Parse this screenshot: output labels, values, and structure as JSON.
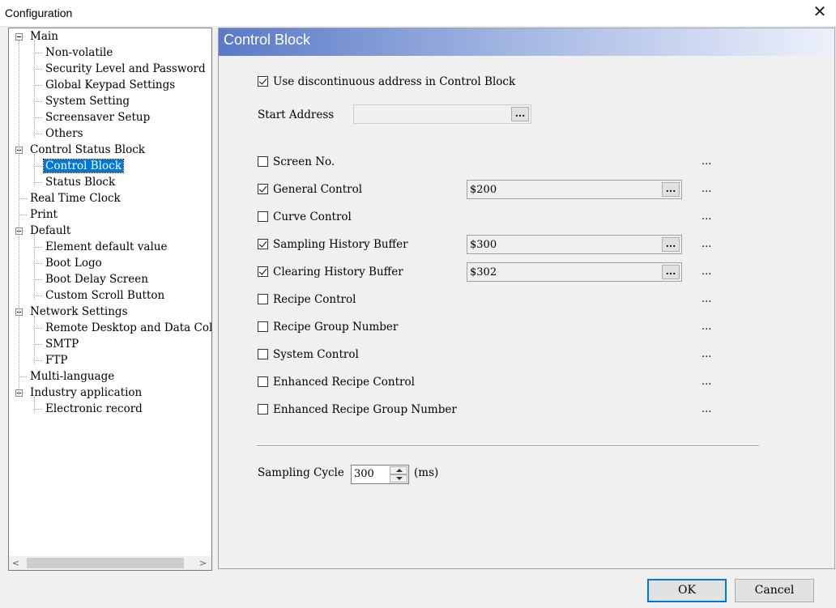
{
  "window": {
    "title": "Configuration",
    "close_icon": "close-icon"
  },
  "tree": {
    "items": [
      {
        "label": "Main",
        "level": 0,
        "expander": true
      },
      {
        "label": "Non-volatile",
        "level": 1
      },
      {
        "label": "Security Level and Password",
        "level": 1
      },
      {
        "label": "Global Keypad Settings",
        "level": 1
      },
      {
        "label": "System Setting",
        "level": 1
      },
      {
        "label": "Screensaver Setup",
        "level": 1
      },
      {
        "label": "Others",
        "level": 1
      },
      {
        "label": "Control Status Block",
        "level": 0,
        "expander": true
      },
      {
        "label": "Control Block",
        "level": 1,
        "selected": true
      },
      {
        "label": "Status Block",
        "level": 1
      },
      {
        "label": "Real Time Clock",
        "level": 0
      },
      {
        "label": "Print",
        "level": 0
      },
      {
        "label": "Default",
        "level": 0,
        "expander": true
      },
      {
        "label": "Element default value",
        "level": 1
      },
      {
        "label": "Boot Logo",
        "level": 1
      },
      {
        "label": "Boot Delay Screen",
        "level": 1
      },
      {
        "label": "Custom Scroll Button",
        "level": 1
      },
      {
        "label": "Network Settings",
        "level": 0,
        "expander": true
      },
      {
        "label": "Remote Desktop and Data Collecti",
        "level": 1
      },
      {
        "label": "SMTP",
        "level": 1
      },
      {
        "label": "FTP",
        "level": 1
      },
      {
        "label": "Multi-language",
        "level": 0
      },
      {
        "label": "Industry application",
        "level": 0,
        "expander": true
      },
      {
        "label": "Electronic record",
        "level": 1
      }
    ],
    "scroll_left": "<",
    "scroll_right": ">"
  },
  "content": {
    "header": "Control Block",
    "use_discontinuous": {
      "label": "Use discontinuous address in Control Block",
      "checked": true
    },
    "start_address": {
      "label": "Start Address",
      "value": "",
      "browse": "..."
    },
    "options": [
      {
        "label": "Screen No.",
        "checked": false,
        "value": null,
        "more": "..."
      },
      {
        "label": "General Control",
        "checked": true,
        "value": "$200",
        "more": "..."
      },
      {
        "label": "Curve Control",
        "checked": false,
        "value": null,
        "more": "..."
      },
      {
        "label": "Sampling History Buffer",
        "checked": true,
        "value": "$300",
        "more": "..."
      },
      {
        "label": "Clearing History Buffer",
        "checked": true,
        "value": "$302",
        "more": "..."
      },
      {
        "label": "Recipe Control",
        "checked": false,
        "value": null,
        "more": "..."
      },
      {
        "label": "Recipe Group Number",
        "checked": false,
        "value": null,
        "more": "..."
      },
      {
        "label": "System Control",
        "checked": false,
        "value": null,
        "more": "..."
      },
      {
        "label": "Enhanced Recipe Control",
        "checked": false,
        "value": null,
        "more": "..."
      },
      {
        "label": "Enhanced Recipe Group Number",
        "checked": false,
        "value": null,
        "more": "..."
      }
    ],
    "browse_label": "...",
    "sampling_cycle": {
      "label": "Sampling Cycle",
      "value": "300",
      "unit": "(ms)"
    }
  },
  "footer": {
    "ok": "OK",
    "cancel": "Cancel"
  },
  "colors": {
    "selection": "#0078d7",
    "header_start": "#5a79c7",
    "header_end": "#edf1fb"
  }
}
